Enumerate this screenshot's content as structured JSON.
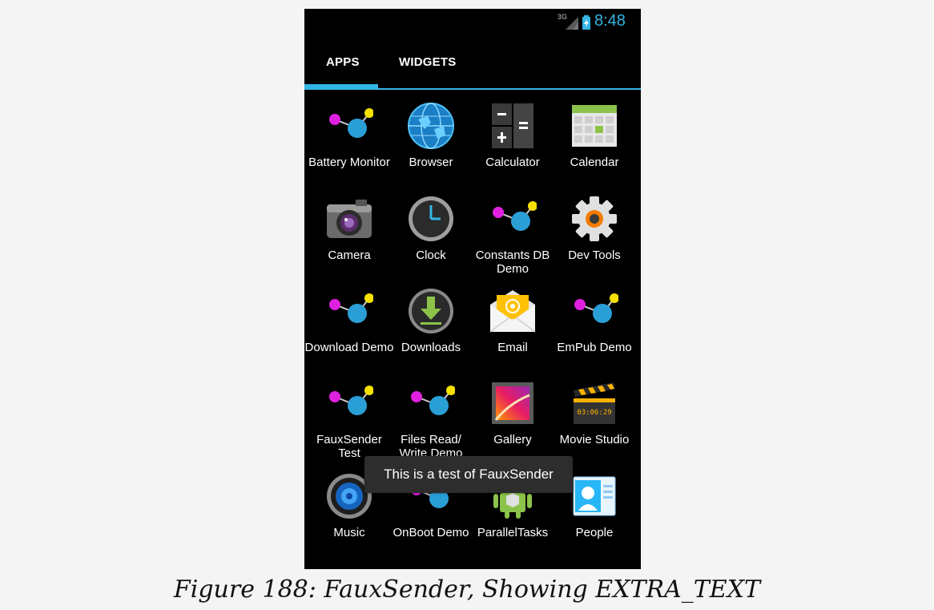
{
  "status_bar": {
    "network_type": "3G",
    "time": "8:48",
    "accent_color": "#33b5e5"
  },
  "tabs": [
    {
      "label": "APPS",
      "selected": true
    },
    {
      "label": "WIDGETS",
      "selected": false
    }
  ],
  "apps": [
    {
      "label": "Battery Monitor",
      "icon": "molecule-icon"
    },
    {
      "label": "Browser",
      "icon": "globe-icon"
    },
    {
      "label": "Calculator",
      "icon": "calculator-icon"
    },
    {
      "label": "Calendar",
      "icon": "calendar-icon"
    },
    {
      "label": "Camera",
      "icon": "camera-icon"
    },
    {
      "label": "Clock",
      "icon": "clock-icon"
    },
    {
      "label": "Constants DB Demo",
      "icon": "molecule-icon"
    },
    {
      "label": "Dev Tools",
      "icon": "gear-icon"
    },
    {
      "label": "Download Demo",
      "icon": "molecule-icon"
    },
    {
      "label": "Downloads",
      "icon": "download-icon"
    },
    {
      "label": "Email",
      "icon": "envelope-icon"
    },
    {
      "label": "EmPub Demo",
      "icon": "molecule-icon"
    },
    {
      "label": "FauxSender Test",
      "icon": "molecule-icon"
    },
    {
      "label": "Files Read/ Write Demo",
      "icon": "molecule-icon"
    },
    {
      "label": "Gallery",
      "icon": "gallery-icon"
    },
    {
      "label": "Movie Studio",
      "icon": "clapperboard-icon"
    },
    {
      "label": "Music",
      "icon": "speaker-icon"
    },
    {
      "label": "OnBoot Demo",
      "icon": "molecule-icon"
    },
    {
      "label": "ParallelTasks",
      "icon": "android-icon"
    },
    {
      "label": "People",
      "icon": "contact-card-icon"
    }
  ],
  "movie_studio_timecode": "03:06:29",
  "toast": {
    "message": "This is a test of FauxSender"
  },
  "caption": "Figure 188: FauxSender, Showing EXTRA_TEXT"
}
